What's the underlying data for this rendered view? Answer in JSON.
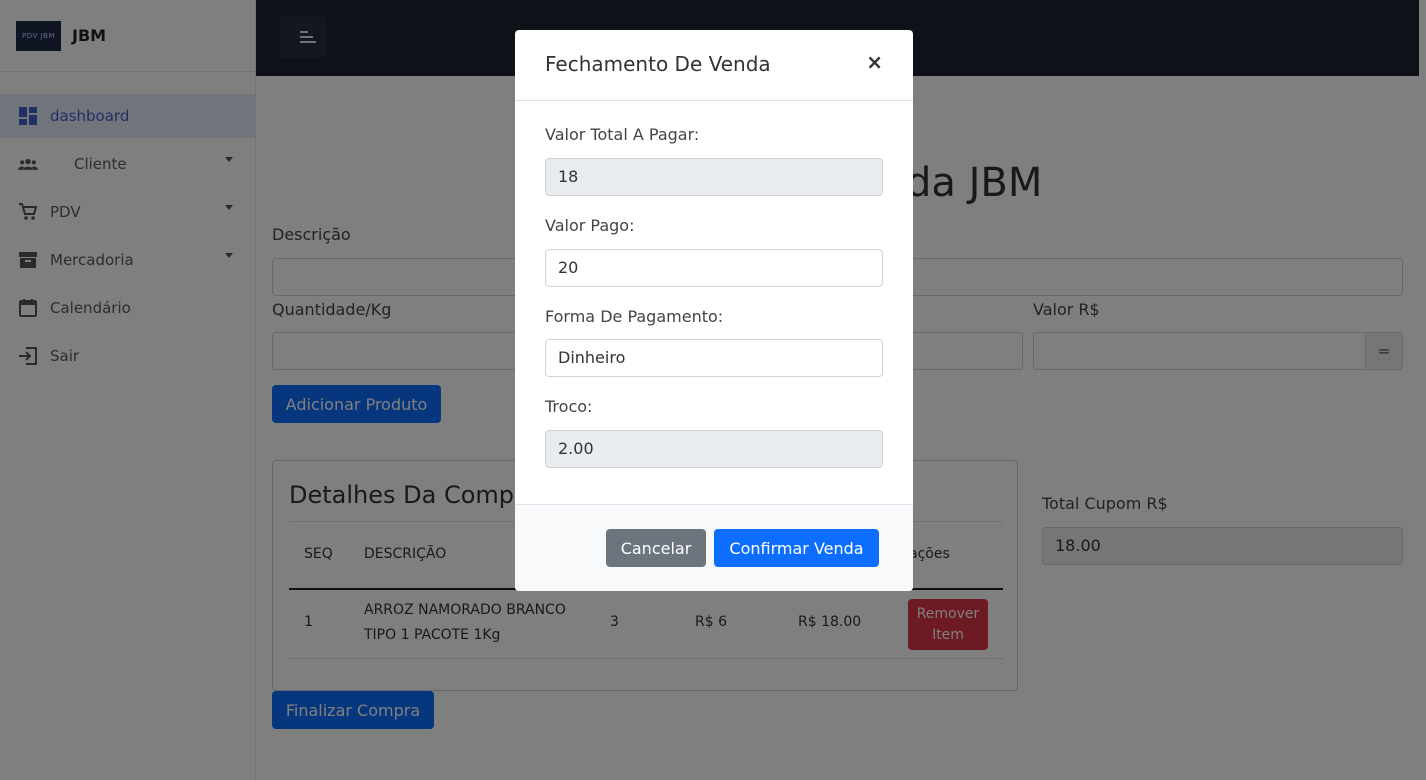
{
  "brand": {
    "logo_text": "PDV JBM",
    "name": "JBM"
  },
  "sidebar": {
    "items": [
      {
        "label": "dashboard"
      },
      {
        "label": "Cliente"
      },
      {
        "label": "PDV"
      },
      {
        "label": "Mercadoria"
      },
      {
        "label": "Calendário"
      },
      {
        "label": "Sair"
      }
    ]
  },
  "main": {
    "title": "da JBM",
    "descricao_label": "Descrição",
    "quantidade_label": "Quantidade/Kg",
    "valor_label": "Valor R$",
    "equals_label": "=",
    "add_button": "Adicionar Produto",
    "details_title": "Detalhes Da Comp",
    "table_headers": [
      "SEQ",
      "DESCRIÇÃO",
      "ações"
    ],
    "row": {
      "seq": "1",
      "desc_line1": "ARROZ NAMORADO BRANCO",
      "desc_line2": "TIPO 1 PACOTE 1Kg",
      "qty": "3",
      "price": "R$ 6",
      "total": "R$ 18.00",
      "remove_line1": "Remover",
      "remove_line2": "Item"
    },
    "total_cupom_label": "Total Cupom R$",
    "total_cupom_value": "18.00",
    "finalize_button": "Finalizar Compra"
  },
  "modal": {
    "title": "Fechamento De Venda",
    "close": "×",
    "total_label": "Valor Total A Pagar:",
    "total_value": "18",
    "pago_label": "Valor Pago:",
    "pago_value": "20",
    "forma_label": "Forma De Pagamento:",
    "forma_value": "Dinheiro",
    "troco_label": "Troco:",
    "troco_value": "2.00",
    "cancel_button": "Cancelar",
    "confirm_button": "Confirmar Venda"
  },
  "colors": {
    "primary": "#0d6efd",
    "danger": "#dc3545",
    "secondary": "#6c757d",
    "topbar": "#1f2332",
    "active_nav": "#4361c9"
  }
}
